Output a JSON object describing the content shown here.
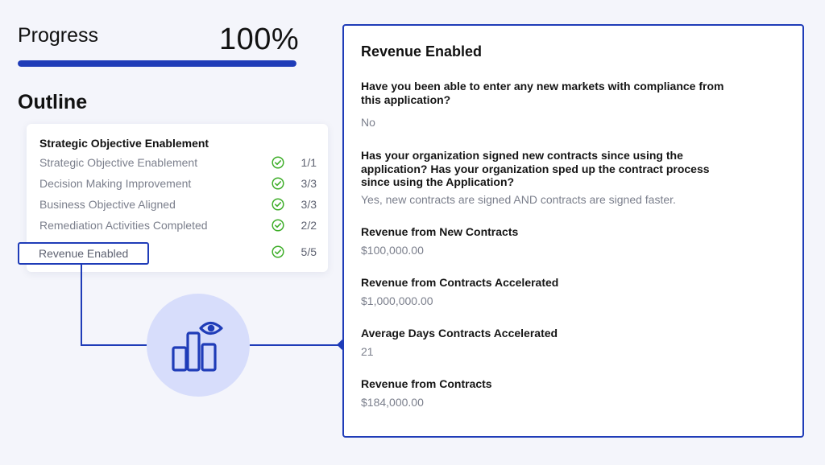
{
  "progress": {
    "title": "Progress",
    "value_label": "100%",
    "fraction": 1.0
  },
  "outline": {
    "title": "Outline",
    "section_heading": "Strategic Objective Enablement",
    "items": [
      {
        "label": "Strategic Objective Enablement",
        "count": "1/1",
        "icon": "check-circle-icon"
      },
      {
        "label": "Decision Making Improvement",
        "count": "3/3",
        "icon": "check-circle-icon"
      },
      {
        "label": "Business Objective Aligned",
        "count": "3/3",
        "icon": "check-circle-icon"
      },
      {
        "label": "Remediation Activities Completed",
        "count": "2/2",
        "icon": "check-circle-icon"
      },
      {
        "label": "Revenue Enabled",
        "count": "5/5",
        "icon": "check-circle-icon",
        "selected": true
      }
    ]
  },
  "detail": {
    "title": "Revenue Enabled",
    "fields": [
      {
        "question": "Have you been able to enter any new markets with compliance from this application?",
        "answer": "No"
      },
      {
        "question": "Has your organization signed new contracts since using the application? Has your organization sped up the contract process since using the Application?",
        "answer": "Yes, new contracts are signed AND contracts are signed faster."
      },
      {
        "question": "Revenue from New Contracts",
        "answer": "$100,000.00"
      },
      {
        "question": "Revenue from Contracts Accelerated",
        "answer": "$1,000,000.00"
      },
      {
        "question": "Average Days Contracts Accelerated",
        "answer": "21"
      },
      {
        "question": "Revenue from Contracts",
        "answer": "$184,000.00"
      }
    ]
  },
  "colors": {
    "accent": "#1f3cb8",
    "check": "#3fae2a",
    "icon_bg": "#d7ddfb",
    "page_bg": "#f4f5fb"
  },
  "icons": {
    "center": "analytics-eye-icon"
  }
}
